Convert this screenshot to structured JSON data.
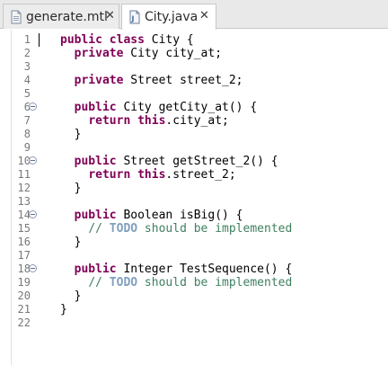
{
  "tabs": [
    {
      "label": "generate.mtl",
      "icon": "file-icon",
      "close": "✕",
      "active": false
    },
    {
      "label": "City.java",
      "icon": "java-file-icon",
      "close": "✕",
      "active": true
    }
  ],
  "editor": {
    "lines": [
      {
        "num": "1",
        "fold": false,
        "tokens": [
          {
            "t": "kw",
            "v": "public"
          },
          {
            "t": "p",
            "v": " "
          },
          {
            "t": "kw",
            "v": "class"
          },
          {
            "t": "p",
            "v": " City {"
          }
        ]
      },
      {
        "num": "2",
        "fold": false,
        "tokens": [
          {
            "t": "p",
            "v": "  "
          },
          {
            "t": "kw",
            "v": "private"
          },
          {
            "t": "p",
            "v": " City city_at;"
          }
        ]
      },
      {
        "num": "3",
        "fold": false,
        "tokens": []
      },
      {
        "num": "4",
        "fold": false,
        "tokens": [
          {
            "t": "p",
            "v": "  "
          },
          {
            "t": "kw",
            "v": "private"
          },
          {
            "t": "p",
            "v": " Street street_2;"
          }
        ]
      },
      {
        "num": "5",
        "fold": false,
        "tokens": []
      },
      {
        "num": "6",
        "fold": true,
        "tokens": [
          {
            "t": "p",
            "v": "  "
          },
          {
            "t": "kw",
            "v": "public"
          },
          {
            "t": "p",
            "v": " City getCity_at() {"
          }
        ]
      },
      {
        "num": "7",
        "fold": false,
        "tokens": [
          {
            "t": "p",
            "v": "    "
          },
          {
            "t": "kw",
            "v": "return"
          },
          {
            "t": "p",
            "v": " "
          },
          {
            "t": "kw",
            "v": "this"
          },
          {
            "t": "p",
            "v": ".city_at;"
          }
        ]
      },
      {
        "num": "8",
        "fold": false,
        "tokens": [
          {
            "t": "p",
            "v": "  }"
          }
        ]
      },
      {
        "num": "9",
        "fold": false,
        "tokens": []
      },
      {
        "num": "10",
        "fold": true,
        "tokens": [
          {
            "t": "p",
            "v": "  "
          },
          {
            "t": "kw",
            "v": "public"
          },
          {
            "t": "p",
            "v": " Street getStreet_2() {"
          }
        ]
      },
      {
        "num": "11",
        "fold": false,
        "tokens": [
          {
            "t": "p",
            "v": "    "
          },
          {
            "t": "kw",
            "v": "return"
          },
          {
            "t": "p",
            "v": " "
          },
          {
            "t": "kw",
            "v": "this"
          },
          {
            "t": "p",
            "v": ".street_2;"
          }
        ]
      },
      {
        "num": "12",
        "fold": false,
        "tokens": [
          {
            "t": "p",
            "v": "  }"
          }
        ]
      },
      {
        "num": "13",
        "fold": false,
        "tokens": []
      },
      {
        "num": "14",
        "fold": true,
        "tokens": [
          {
            "t": "p",
            "v": "  "
          },
          {
            "t": "kw",
            "v": "public"
          },
          {
            "t": "p",
            "v": " Boolean isBig() {"
          }
        ]
      },
      {
        "num": "15",
        "fold": false,
        "tokens": [
          {
            "t": "p",
            "v": "    "
          },
          {
            "t": "cm",
            "v": "// "
          },
          {
            "t": "todo",
            "v": "TODO"
          },
          {
            "t": "cm",
            "v": " should be implemented"
          }
        ]
      },
      {
        "num": "16",
        "fold": false,
        "tokens": [
          {
            "t": "p",
            "v": "  }"
          }
        ]
      },
      {
        "num": "17",
        "fold": false,
        "tokens": []
      },
      {
        "num": "18",
        "fold": true,
        "tokens": [
          {
            "t": "p",
            "v": "  "
          },
          {
            "t": "kw",
            "v": "public"
          },
          {
            "t": "p",
            "v": " Integer TestSequence() {"
          }
        ]
      },
      {
        "num": "19",
        "fold": false,
        "tokens": [
          {
            "t": "p",
            "v": "    "
          },
          {
            "t": "cm",
            "v": "// "
          },
          {
            "t": "todo",
            "v": "TODO"
          },
          {
            "t": "cm",
            "v": " should be implemented"
          }
        ]
      },
      {
        "num": "20",
        "fold": false,
        "tokens": [
          {
            "t": "p",
            "v": "  }"
          }
        ]
      },
      {
        "num": "21",
        "fold": false,
        "tokens": [
          {
            "t": "p",
            "v": "}"
          }
        ]
      },
      {
        "num": "22",
        "fold": false,
        "tokens": []
      }
    ]
  },
  "colors": {
    "keyword": "#7f0055",
    "comment": "#3f7f5f",
    "todo": "#7f9fbf",
    "line_number": "#787878"
  }
}
